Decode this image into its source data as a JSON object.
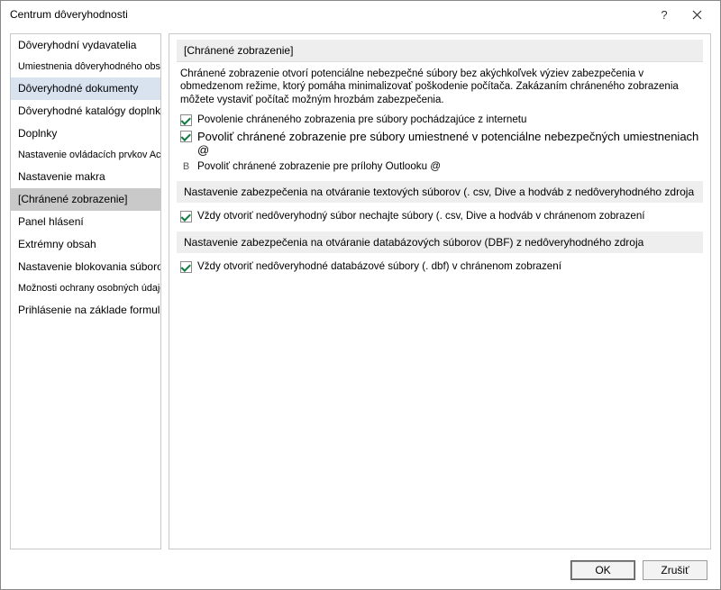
{
  "window": {
    "title": "Centrum dôveryhodnosti"
  },
  "sidebar": {
    "items": [
      {
        "label": "Dôveryhodní vydavatelia"
      },
      {
        "label": "Umiestnenia dôveryhodného obsahu"
      },
      {
        "label": "Dôveryhodné dokumenty"
      },
      {
        "label": "Dôveryhodné katalógy doplnkov"
      },
      {
        "label": "Doplnky"
      },
      {
        "label": "Nastavenie ovládacích prvkov ActiveX"
      },
      {
        "label": "Nastavenie makra"
      },
      {
        "label": "[Chránené zobrazenie]"
      },
      {
        "label": "Panel hlásení"
      },
      {
        "label": "Extrémny obsah"
      },
      {
        "label": "Nastavenie blokovania súborov"
      },
      {
        "label": "Možnosti ochrany osobných údajov"
      },
      {
        "label": "Prihlásenie na základe formulára"
      }
    ]
  },
  "content": {
    "group1": {
      "header": "[Chránené zobrazenie]",
      "description": "Chránené zobrazenie otvorí potenciálne nebezpečné súbory bez akýchkoľvek výziev zabezpečenia v obmedzenom režime, ktorý pomáha minimalizovať poškodenie počítača. Zakázaním chráneného zobrazenia môžete vystaviť počítač možným hrozbám zabezpečenia.",
      "opt1": "Povolenie chráneného zobrazenia pre súbory pochádzajúce z internetu",
      "opt2": "Povoliť chránené zobrazenie pre súbory umiestnené v potenciálne nebezpečných umiestneniach @",
      "opt3_prefix": "B",
      "opt3": "Povoliť chránené zobrazenie pre prílohy Outlooku @"
    },
    "group2": {
      "header": "Nastavenie zabezpečenia na otváranie textových súborov (. csv, Dive a hodváb z nedôveryhodného zdroja",
      "opt1": "Vždy otvoriť nedôveryhodný súbor nechajte súbory (. csv, Dive a hodváb v chránenom zobrazení"
    },
    "group3": {
      "header": "Nastavenie zabezpečenia na otváranie databázových súborov (DBF) z nedôveryhodného zdroja",
      "opt1": "Vždy otvoriť nedôveryhodné databázové súbory (. dbf) v chránenom zobrazení"
    }
  },
  "footer": {
    "ok": "OK",
    "cancel": "Zrušiť"
  }
}
